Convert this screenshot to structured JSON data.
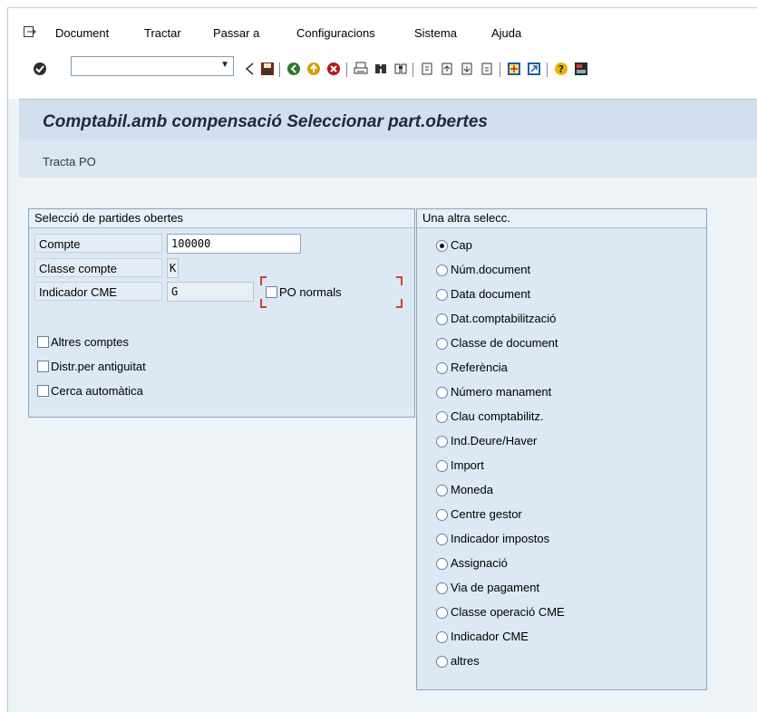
{
  "menu": {
    "items": [
      "Document",
      "Tractar",
      "Passar a",
      "Configuracions",
      "Sistema",
      "Ajuda"
    ]
  },
  "toolbar": {
    "command_value": ""
  },
  "page": {
    "title": "Comptabil.amb compensació Seleccionar part.obertes",
    "subbar_button": "Tracta PO"
  },
  "selection_group": {
    "title": "Selecció de partides obertes",
    "fields": [
      {
        "label": "Compte",
        "value": "100000"
      },
      {
        "label": "Classe compte",
        "value": "K"
      },
      {
        "label": "Indicador CME",
        "value": "G"
      }
    ],
    "po_normals_label": "PO normals",
    "checkboxes": [
      "Altres comptes",
      "Distr.per antiguitat",
      "Cerca automàtica"
    ]
  },
  "other_group": {
    "title": "Una altra selecc.",
    "selected": "Cap",
    "options": [
      "Cap",
      "Núm.document",
      "Data document",
      "Dat.comptabilització",
      "Classe de document",
      "Referència",
      "Número manament",
      "Clau comptabilitz.",
      "Ind.Deure/Haver",
      "Import",
      "Moneda",
      "Centre gestor",
      "Indicador impostos",
      "Assignació",
      "Via de pagament",
      "Classe operació CME",
      "Indicador CME",
      "altres"
    ]
  }
}
